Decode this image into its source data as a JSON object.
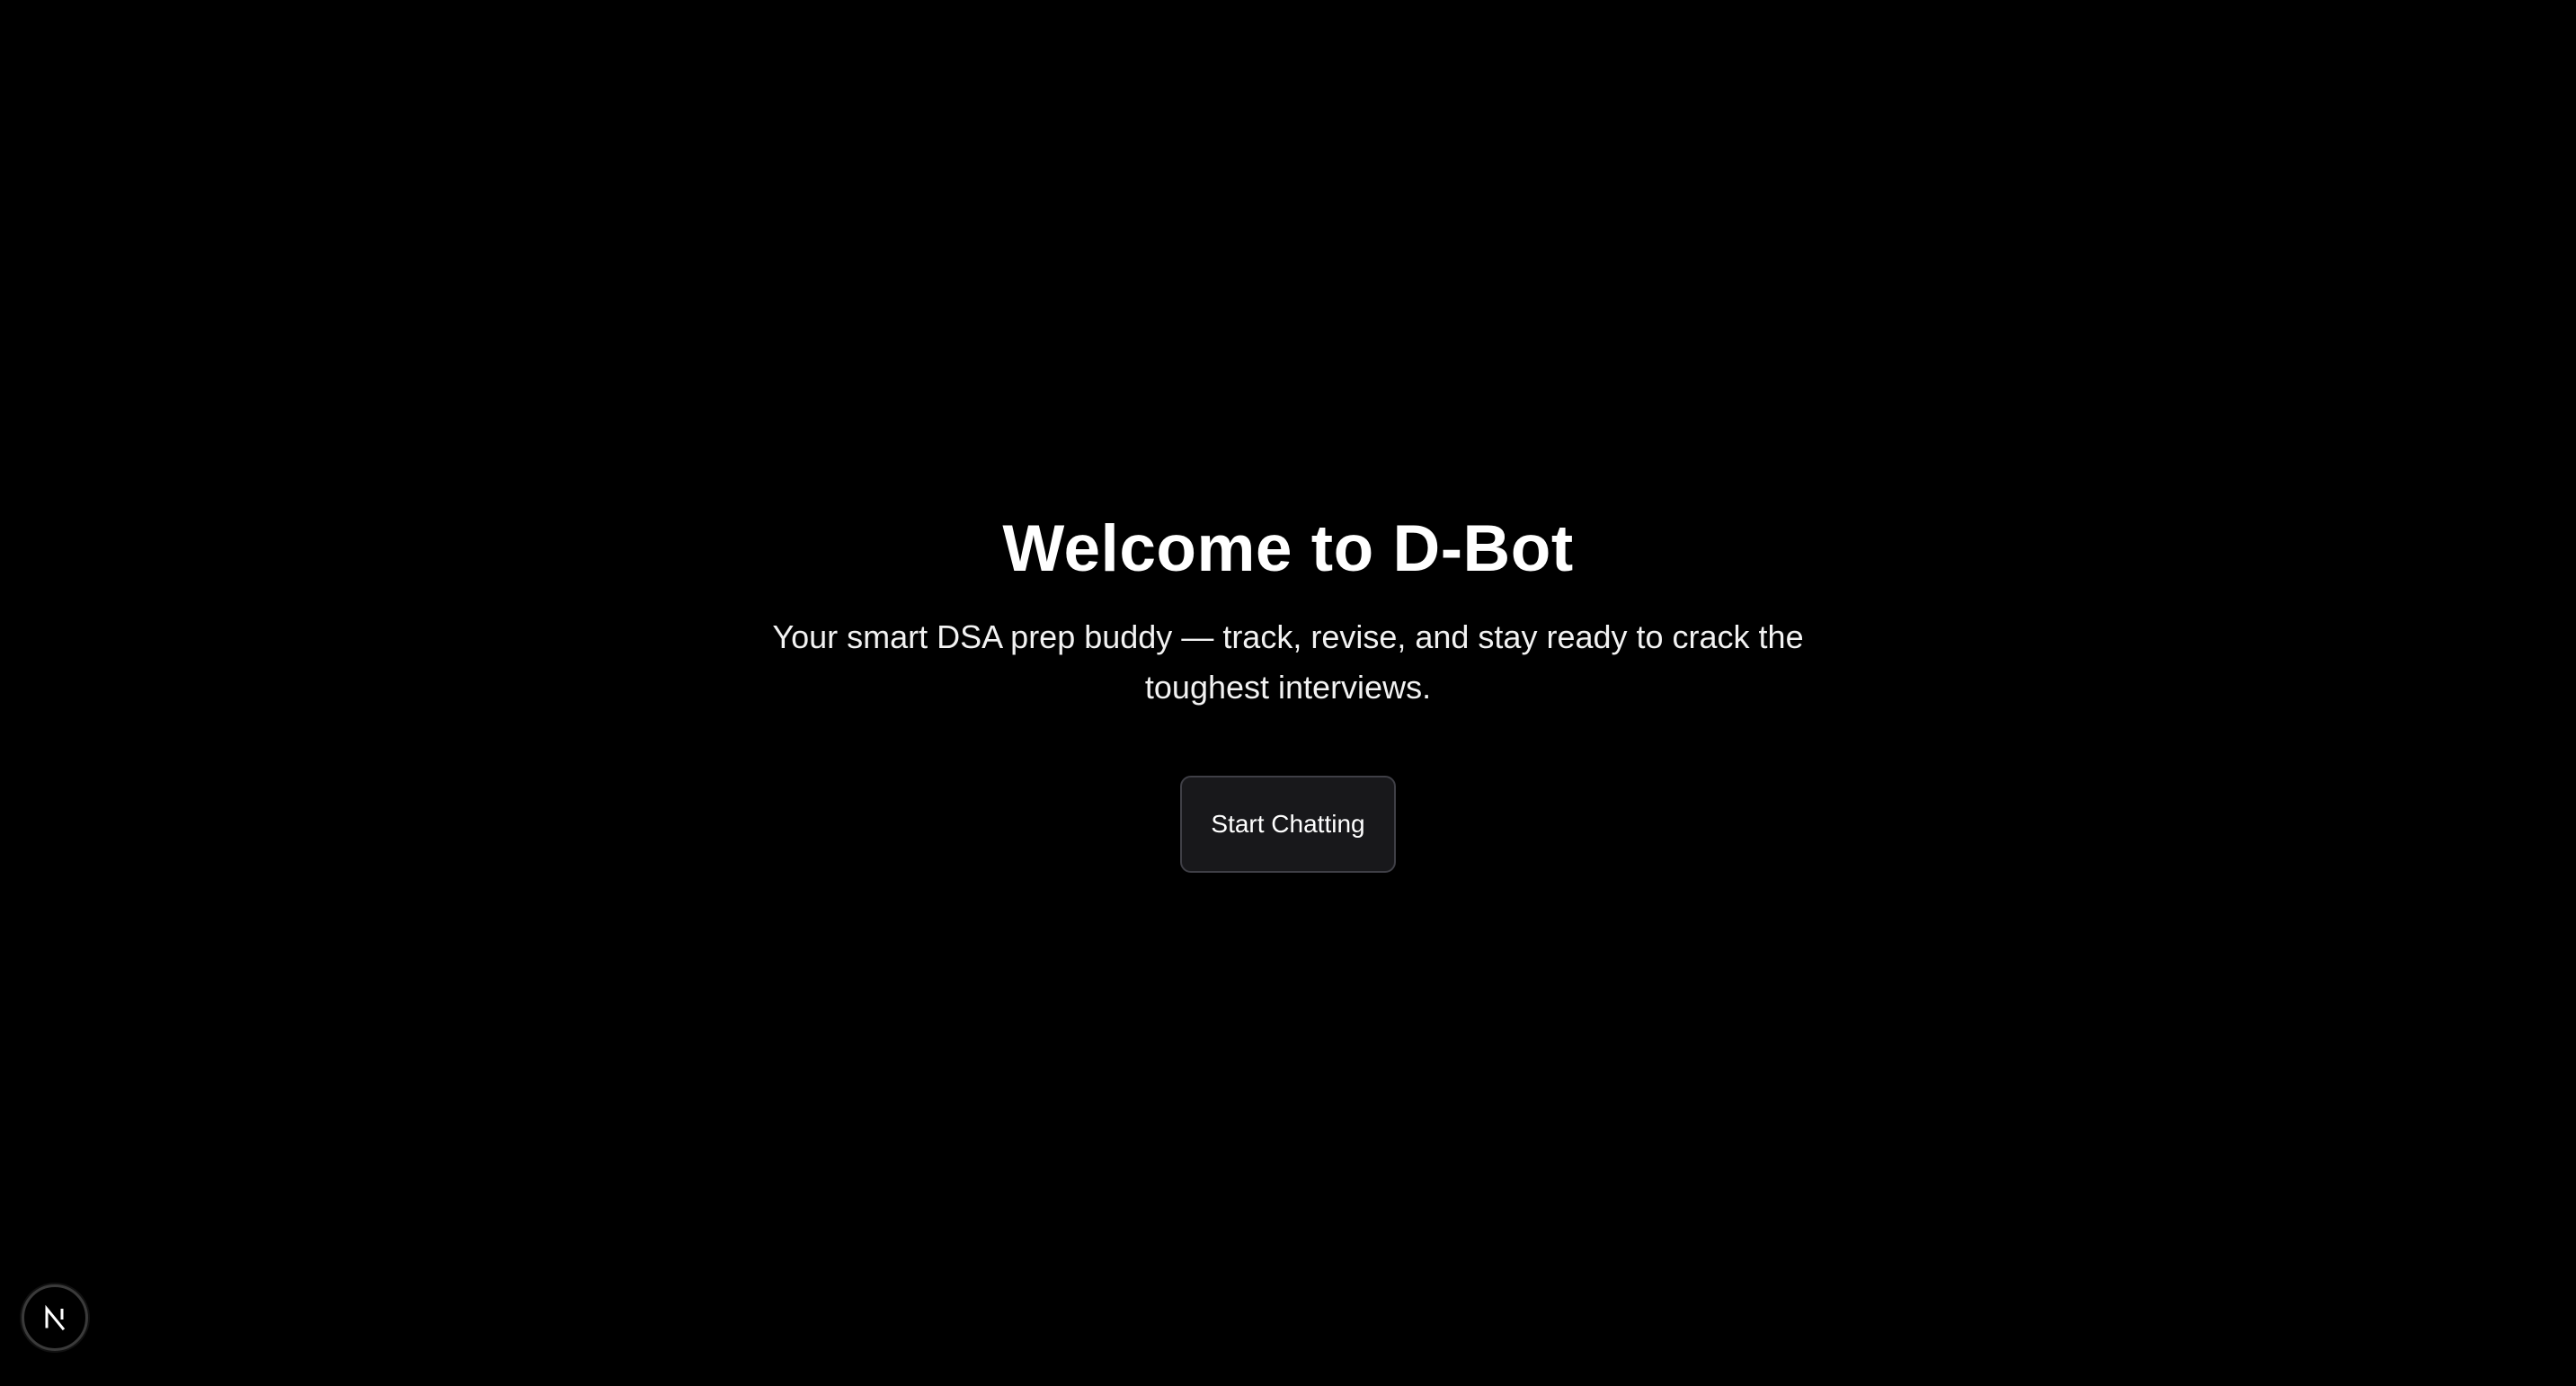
{
  "hero": {
    "title": "Welcome to D-Bot",
    "subtitle": "Your smart DSA prep buddy — track, revise, and stay ready to crack the toughest interviews.",
    "cta_label": "Start Chatting"
  },
  "dev_badge": {
    "icon": "nextjs-logo-icon",
    "label": "N"
  },
  "colors": {
    "background": "#000000",
    "text": "#ffffff",
    "button_bg": "#18181b",
    "button_border": "#3f3f46"
  }
}
